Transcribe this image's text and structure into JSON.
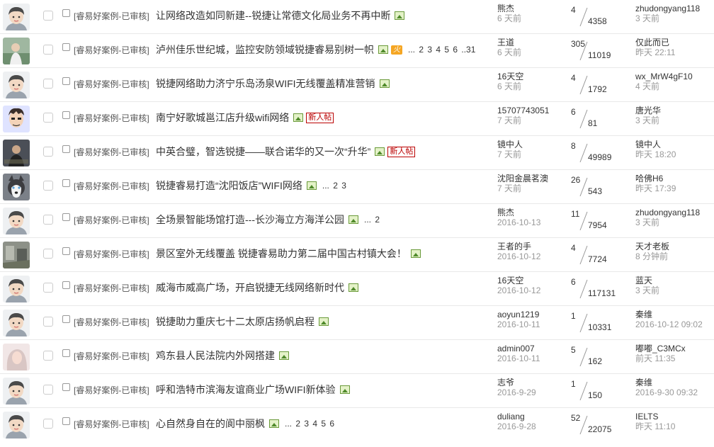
{
  "threads": [
    {
      "category": "[睿易好案例-已审核]",
      "title": "让网络改造如同新建--锐捷让常德文化局业务不再中断",
      "has_image": true,
      "hot": null,
      "new_badge": null,
      "pages": null,
      "author": "熊杰",
      "post_date": "6 天前",
      "replies": "4",
      "views": "4358",
      "last_poster": "zhudongyang118",
      "last_time": "3 天前",
      "avatar": "default"
    },
    {
      "category": "[睿易好案例-已审核]",
      "title": "泸州佳乐世纪城，监控安防领域锐捷睿易别树一帜",
      "has_image": true,
      "hot": "火",
      "new_badge": null,
      "pages": "... 2 3 4 5 6 ..31",
      "author": "王道",
      "post_date": "6 天前",
      "replies": "305",
      "views": "11019",
      "last_poster": "仅此而已",
      "last_time": "昨天 22:11",
      "avatar": "photo-green"
    },
    {
      "category": "[睿易好案例-已审核]",
      "title": "锐捷网络助力济宁乐岛汤泉WIFI无线覆盖精准营销",
      "has_image": true,
      "hot": null,
      "new_badge": null,
      "pages": null,
      "author": "16天空",
      "post_date": "6 天前",
      "replies": "4",
      "views": "1792",
      "last_poster": "wx_MrW4gF10",
      "last_time": "4 天前",
      "avatar": "default"
    },
    {
      "category": "[睿易好案例-已审核]",
      "title": "南宁好歌城邕江店升级wifi网络",
      "has_image": true,
      "hot": null,
      "new_badge": "新人帖",
      "pages": null,
      "author": "15707743051",
      "post_date": "7 天前",
      "replies": "6",
      "views": "81",
      "last_poster": "唐光华",
      "last_time": "3 天前",
      "avatar": "cartoon"
    },
    {
      "category": "[睿易好案例-已审核]",
      "title": "中英合璧，智选锐捷——联合诺华的又一次“升华”",
      "has_image": true,
      "hot": null,
      "new_badge": "新人帖",
      "pages": null,
      "author": "镜中人",
      "post_date": "7 天前",
      "replies": "8",
      "views": "49989",
      "last_poster": "镜中人",
      "last_time": "昨天 18:20",
      "avatar": "photo-dark"
    },
    {
      "category": "[睿易好案例-已审核]",
      "title": "锐捷睿易打造“沈阳饭店”WIFI网络",
      "has_image": true,
      "hot": null,
      "new_badge": null,
      "pages": "... 2 3",
      "author": "沈阳金晨茗澳",
      "post_date": "7 天前",
      "replies": "26",
      "views": "543",
      "last_poster": "哈佛H6",
      "last_time": "昨天 17:39",
      "avatar": "husky"
    },
    {
      "category": "[睿易好案例-已审核]",
      "title": "全场景智能场馆打造---长沙海立方海洋公园",
      "has_image": true,
      "hot": null,
      "new_badge": null,
      "pages": "... 2",
      "author": "熊杰",
      "post_date": "2016-10-13",
      "replies": "11",
      "views": "7954",
      "last_poster": "zhudongyang118",
      "last_time": "3 天前",
      "avatar": "default"
    },
    {
      "category": "[睿易好案例-已审核]",
      "title": "景区室外无线覆盖 锐捷睿易助力第二届中国古村镇大会！",
      "has_image": true,
      "hot": null,
      "new_badge": null,
      "pages": null,
      "author": "王者的手",
      "post_date": "2016-10-12",
      "replies": "4",
      "views": "7724",
      "last_poster": "天才老板",
      "last_time": "8 分钟前",
      "avatar": "photo-gray"
    },
    {
      "category": "[睿易好案例-已审核]",
      "title": "威海市威高广场，开启锐捷无线网络新时代",
      "has_image": true,
      "hot": null,
      "new_badge": null,
      "pages": null,
      "author": "16天空",
      "post_date": "2016-10-12",
      "replies": "6",
      "views": "117131",
      "last_poster": "蓝天",
      "last_time": "3 天前",
      "avatar": "default"
    },
    {
      "category": "[睿易好案例-已审核]",
      "title": "锐捷助力重庆七十二太原店扬帆启程",
      "has_image": true,
      "hot": null,
      "new_badge": null,
      "pages": null,
      "author": "aoyun1219",
      "post_date": "2016-10-11",
      "replies": "1",
      "views": "10331",
      "last_poster": "秦维",
      "last_time": "2016-10-12 09:02",
      "avatar": "default"
    },
    {
      "category": "[睿易好案例-已审核]",
      "title": "鸡东县人民法院内外网搭建",
      "has_image": true,
      "hot": null,
      "new_badge": null,
      "pages": null,
      "author": "admin007",
      "post_date": "2016-10-11",
      "replies": "5",
      "views": "162",
      "last_poster": "嘟嘟_C3MCx",
      "last_time": "前天 11:35",
      "avatar": "photo-pink"
    },
    {
      "category": "[睿易好案例-已审核]",
      "title": "呼和浩特市滨海友谊商业广场WIFI新体验",
      "has_image": true,
      "hot": null,
      "new_badge": null,
      "pages": null,
      "author": "志爷",
      "post_date": "2016-9-29",
      "replies": "1",
      "views": "150",
      "last_poster": "秦维",
      "last_time": "2016-9-30 09:32",
      "avatar": "default"
    },
    {
      "category": "[睿易好案例-已审核]",
      "title": "心自然身自在的阆中丽枫",
      "has_image": true,
      "hot": null,
      "new_badge": null,
      "pages": "... 2 3 4 5 6",
      "author": "duliang",
      "post_date": "2016-9-28",
      "replies": "52",
      "views": "22075",
      "last_poster": "IELTS",
      "last_time": "昨天 11:10",
      "avatar": "default"
    }
  ],
  "colors": {
    "border": "#e8e8e8",
    "muted": "#999999",
    "new_badge": "#bb0000",
    "hot": "#f5a623"
  }
}
